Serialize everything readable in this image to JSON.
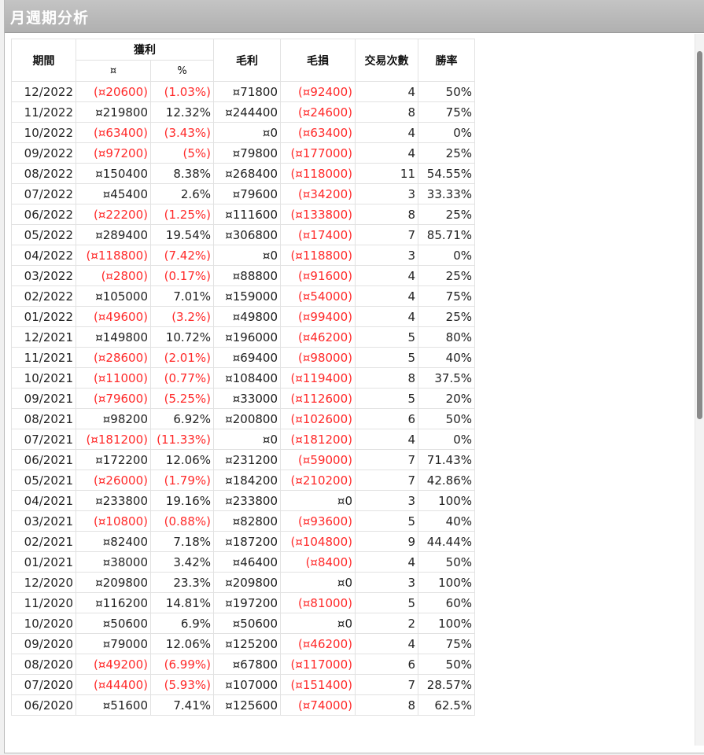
{
  "window": {
    "title": "月週期分析"
  },
  "table": {
    "headers": {
      "period": "期間",
      "profit": "獲利",
      "profit_amount": "¤",
      "profit_percent": "%",
      "gross_profit": "毛利",
      "gross_loss": "毛損",
      "trade_count": "交易次數",
      "win_rate": "勝率"
    },
    "rows": [
      [
        "12/2022",
        "(¤20600)",
        "(1.03%)",
        "¤71800",
        "(¤92400)",
        "4",
        "50%"
      ],
      [
        "11/2022",
        "¤219800",
        "12.32%",
        "¤244400",
        "(¤24600)",
        "8",
        "75%"
      ],
      [
        "10/2022",
        "(¤63400)",
        "(3.43%)",
        "¤0",
        "(¤63400)",
        "4",
        "0%"
      ],
      [
        "09/2022",
        "(¤97200)",
        "(5%)",
        "¤79800",
        "(¤177000)",
        "4",
        "25%"
      ],
      [
        "08/2022",
        "¤150400",
        "8.38%",
        "¤268400",
        "(¤118000)",
        "11",
        "54.55%"
      ],
      [
        "07/2022",
        "¤45400",
        "2.6%",
        "¤79600",
        "(¤34200)",
        "3",
        "33.33%"
      ],
      [
        "06/2022",
        "(¤22200)",
        "(1.25%)",
        "¤111600",
        "(¤133800)",
        "8",
        "25%"
      ],
      [
        "05/2022",
        "¤289400",
        "19.54%",
        "¤306800",
        "(¤17400)",
        "7",
        "85.71%"
      ],
      [
        "04/2022",
        "(¤118800)",
        "(7.42%)",
        "¤0",
        "(¤118800)",
        "3",
        "0%"
      ],
      [
        "03/2022",
        "(¤2800)",
        "(0.17%)",
        "¤88800",
        "(¤91600)",
        "4",
        "25%"
      ],
      [
        "02/2022",
        "¤105000",
        "7.01%",
        "¤159000",
        "(¤54000)",
        "4",
        "75%"
      ],
      [
        "01/2022",
        "(¤49600)",
        "(3.2%)",
        "¤49800",
        "(¤99400)",
        "4",
        "25%"
      ],
      [
        "12/2021",
        "¤149800",
        "10.72%",
        "¤196000",
        "(¤46200)",
        "5",
        "80%"
      ],
      [
        "11/2021",
        "(¤28600)",
        "(2.01%)",
        "¤69400",
        "(¤98000)",
        "5",
        "40%"
      ],
      [
        "10/2021",
        "(¤11000)",
        "(0.77%)",
        "¤108400",
        "(¤119400)",
        "8",
        "37.5%"
      ],
      [
        "09/2021",
        "(¤79600)",
        "(5.25%)",
        "¤33000",
        "(¤112600)",
        "5",
        "20%"
      ],
      [
        "08/2021",
        "¤98200",
        "6.92%",
        "¤200800",
        "(¤102600)",
        "6",
        "50%"
      ],
      [
        "07/2021",
        "(¤181200)",
        "(11.33%)",
        "¤0",
        "(¤181200)",
        "4",
        "0%"
      ],
      [
        "06/2021",
        "¤172200",
        "12.06%",
        "¤231200",
        "(¤59000)",
        "7",
        "71.43%"
      ],
      [
        "05/2021",
        "(¤26000)",
        "(1.79%)",
        "¤184200",
        "(¤210200)",
        "7",
        "42.86%"
      ],
      [
        "04/2021",
        "¤233800",
        "19.16%",
        "¤233800",
        "¤0",
        "3",
        "100%"
      ],
      [
        "03/2021",
        "(¤10800)",
        "(0.88%)",
        "¤82800",
        "(¤93600)",
        "5",
        "40%"
      ],
      [
        "02/2021",
        "¤82400",
        "7.18%",
        "¤187200",
        "(¤104800)",
        "9",
        "44.44%"
      ],
      [
        "01/2021",
        "¤38000",
        "3.42%",
        "¤46400",
        "(¤8400)",
        "4",
        "50%"
      ],
      [
        "12/2020",
        "¤209800",
        "23.3%",
        "¤209800",
        "¤0",
        "3",
        "100%"
      ],
      [
        "11/2020",
        "¤116200",
        "14.81%",
        "¤197200",
        "(¤81000)",
        "5",
        "60%"
      ],
      [
        "10/2020",
        "¤50600",
        "6.9%",
        "¤50600",
        "¤0",
        "2",
        "100%"
      ],
      [
        "09/2020",
        "¤79000",
        "12.06%",
        "¤125200",
        "(¤46200)",
        "4",
        "75%"
      ],
      [
        "08/2020",
        "(¤49200)",
        "(6.99%)",
        "¤67800",
        "(¤117000)",
        "6",
        "50%"
      ],
      [
        "07/2020",
        "(¤44400)",
        "(5.93%)",
        "¤107000",
        "(¤151400)",
        "7",
        "28.57%"
      ],
      [
        "06/2020",
        "¤51600",
        "7.41%",
        "¤125600",
        "(¤74000)",
        "8",
        "62.5%"
      ]
    ]
  },
  "colors": {
    "negative": "#ff2a2a",
    "text": "#222222",
    "titlebar": "#b8b8b8"
  }
}
